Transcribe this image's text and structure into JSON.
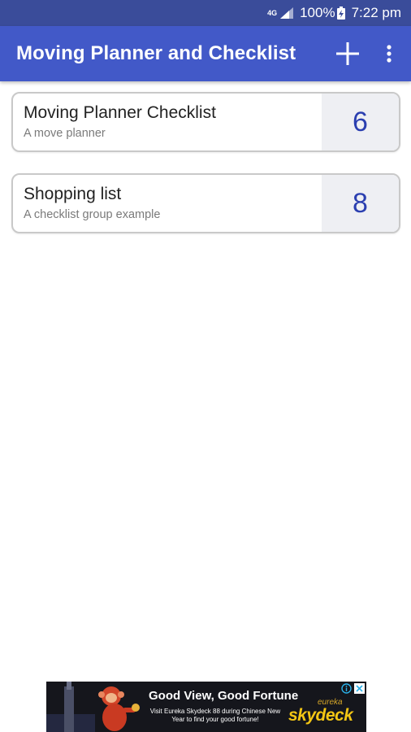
{
  "status_bar": {
    "network_label": "4G",
    "battery_percent": "100%",
    "time": "7:22 pm"
  },
  "app_bar": {
    "title": "Moving Planner and Checklist",
    "add_icon": "plus-icon",
    "menu_icon": "more-vert-icon"
  },
  "checklists": [
    {
      "title": "Moving Planner Checklist",
      "subtitle": "A move planner",
      "count": "6"
    },
    {
      "title": "Shopping list",
      "subtitle": "A checklist group example",
      "count": "8"
    }
  ],
  "ad": {
    "headline": "Good View, Good Fortune",
    "body": "Visit Eureka Skydeck 88 during Chinese New Year to find your good fortune!",
    "brand_small": "eureka",
    "brand": "skydeck"
  },
  "colors": {
    "status_bar": "#3a4c9a",
    "app_bar": "#4259c8",
    "count_text": "#2b3fb0",
    "count_bg": "#eeeff3"
  }
}
